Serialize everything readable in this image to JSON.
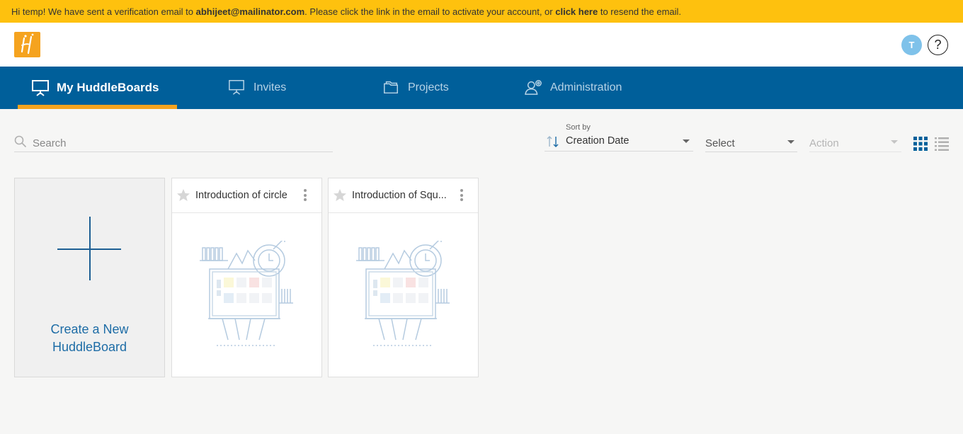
{
  "banner": {
    "prefix": "Hi temp! We have sent a verification email to ",
    "email": "abhijeet@mailinator.com",
    "middle": ".  Please click the link in the email to activate your account, or ",
    "link": "click here",
    "suffix": " to resend the email."
  },
  "header": {
    "avatar_initial": "T",
    "help_symbol": "?"
  },
  "nav": {
    "items": [
      {
        "label": "My HuddleBoards",
        "icon": "presentation-board-icon"
      },
      {
        "label": "Invites",
        "icon": "presentation-board-icon"
      },
      {
        "label": "Projects",
        "icon": "folders-icon"
      },
      {
        "label": "Administration",
        "icon": "user-settings-icon"
      }
    ],
    "active": "My HuddleBoards"
  },
  "toolbar": {
    "search_placeholder": "Search",
    "sort_label": "Sort by",
    "sort_value": "Creation Date",
    "select_value": "Select",
    "action_value": "Action"
  },
  "create_card": {
    "line1": "Create a New",
    "line2": "HuddleBoard"
  },
  "boards": [
    {
      "title": "Introduction of circle",
      "starred": false
    },
    {
      "title": "Introduction of Squ...",
      "starred": false
    }
  ],
  "colors": {
    "banner": "#fec10e",
    "nav": "#005f9a",
    "accent": "#f5a31f",
    "link": "#1d6ca6",
    "avatar": "#7fc2ea"
  }
}
